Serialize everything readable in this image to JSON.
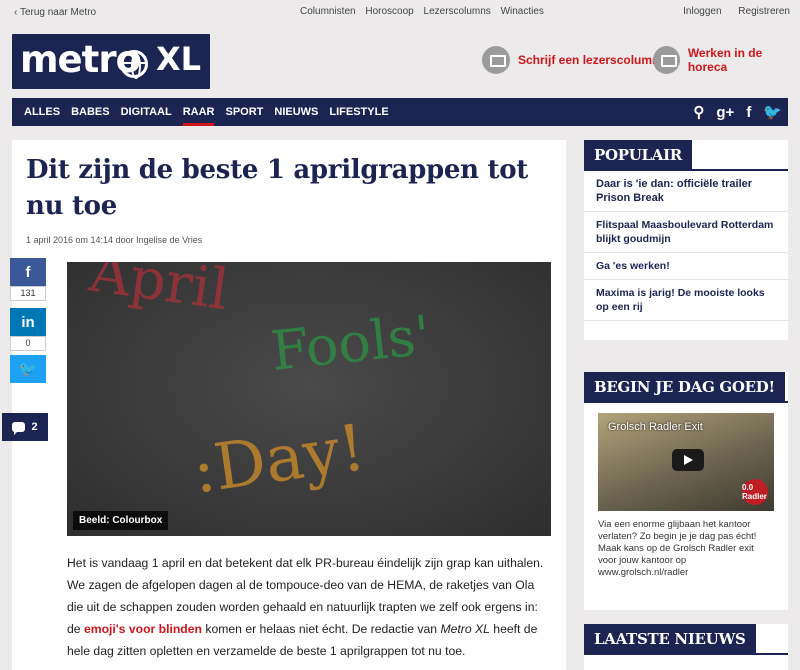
{
  "topbar": {
    "back": "Terug naar Metro",
    "links": [
      "Columnisten",
      "Horoscoop",
      "Lezerscolumns",
      "Winacties"
    ],
    "login": "Inloggen",
    "register": "Registreren"
  },
  "logo": {
    "word": "metro",
    "suffix": "XL"
  },
  "promos": [
    {
      "label": "Schrijf een lezerscolumn!"
    },
    {
      "label": "Werken in de horeca"
    }
  ],
  "nav": {
    "items": [
      "ALLES",
      "BABES",
      "DIGITAAL",
      "RAAR",
      "SPORT",
      "NIEUWS",
      "LIFESTYLE"
    ],
    "active": "RAAR",
    "icons": {
      "search": "⚲",
      "gplus": "g+",
      "facebook": "f",
      "twitter": "🐦"
    }
  },
  "article": {
    "headline": "Dit zijn de beste 1 aprilgrappen tot nu toe",
    "meta": "1 april 2016 om 14:14 door Ingelise de Vries",
    "image_caption": "Beeld: Colourbox",
    "chalk": {
      "line1": "April",
      "line2": "Fools'",
      "line3": ":Day!"
    },
    "body_1": "Het is vandaag 1 april en dat betekent dat elk PR-bureau éindelijk zijn grap kan uithalen. We zagen de afgelopen dagen al de tompouce-deo van de HEMA, de raketjes van Ola die uit de schappen zouden worden gehaald en natuurlijk trapten we zelf ook ergens in: de ",
    "body_link": "emoji's voor blinden",
    "body_2": " komen er helaas niet écht. De redactie van ",
    "body_em": "Metro XL",
    "body_3": " heeft de hele dag zitten opletten en verzamelde de beste 1 aprilgrappen tot nu toe."
  },
  "share": {
    "facebook_icon": "f",
    "facebook_count": "131",
    "linkedin_icon": "in",
    "linkedin_count": "0",
    "twitter_icon": "🐦",
    "comments_count": "2"
  },
  "sidebar": {
    "popular_title": "POPULAIR",
    "popular_items": [
      "Daar is 'ie dan: officiële trailer Prison Break",
      "Flitspaal Maasboulevard Rotterdam blijkt goudmijn",
      "Ga 'es werken!",
      "Maxima is jarig! De mooiste looks op een rij"
    ],
    "begin_title": "BEGIN JE DAG GOED!",
    "video_title": "Grolsch Radler Exit",
    "video_badge": "0.0 Radler",
    "ad_text": "Via een enorme glijbaan het kantoor verlaten? Zo begin je je dag pas écht! Maak kans op de Grolsch Radler exit voor jouw kantoor op www.grolsch.nl/radler",
    "latest_title": "LAATSTE NIEUWS"
  }
}
